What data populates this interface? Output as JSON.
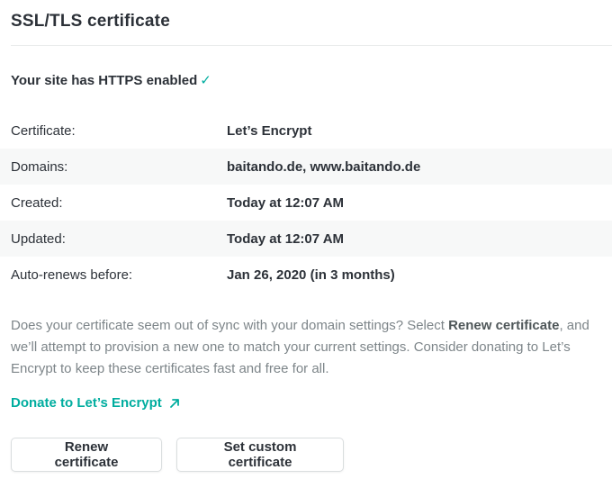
{
  "section": {
    "title": "SSL/TLS certificate"
  },
  "status": {
    "text": "Your site has HTTPS enabled",
    "check_glyph": "✓",
    "check_color": "#00ad9f"
  },
  "certificate": {
    "rows": [
      {
        "label": "Certificate:",
        "value": "Let’s Encrypt"
      },
      {
        "label": "Domains:",
        "value": "baitando.de, www.baitando.de"
      },
      {
        "label": "Created:",
        "value": "Today at 12:07 AM"
      },
      {
        "label": "Updated:",
        "value": "Today at 12:07 AM"
      },
      {
        "label": "Auto-renews before:",
        "value": "Jan 26, 2020 (in 3 months)"
      }
    ]
  },
  "help": {
    "text_before": "Does your certificate seem out of sync with your domain settings? Select ",
    "emphasis": "Renew certificate",
    "text_after": ", and we’ll attempt to provision a new one to match your current settings. Consider donating to Let’s Encrypt to keep these certificates fast and free for all."
  },
  "donate": {
    "label": "Donate to Let’s Encrypt",
    "icon": "external-link-arrow-icon"
  },
  "actions": {
    "renew_label": "Renew certificate",
    "custom_label": "Set custom certificate"
  },
  "colors": {
    "accent": "#00ad9f",
    "text": "#2c3138",
    "muted": "#7d8589",
    "row_shade": "#f7f8f8"
  }
}
